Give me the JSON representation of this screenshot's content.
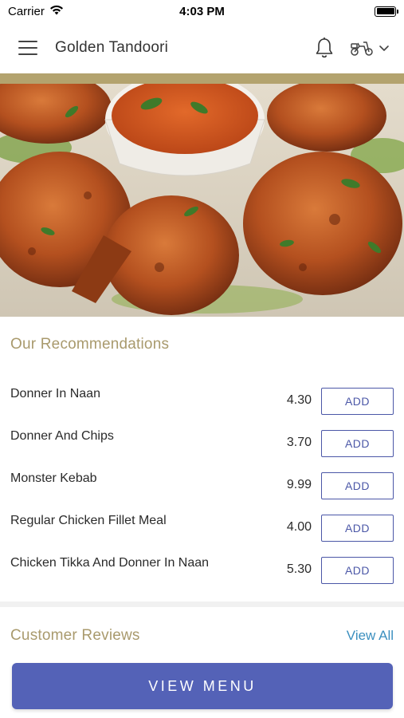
{
  "status_bar": {
    "carrier": "Carrier",
    "time": "4:03 PM"
  },
  "header": {
    "title": "Golden Tandoori",
    "icons": [
      "menu-icon",
      "bell-icon",
      "scooter-icon",
      "chevron-down-icon"
    ]
  },
  "recommendations": {
    "title": "Our Recommendations",
    "add_label": "ADD",
    "items": [
      {
        "name": "Donner In Naan",
        "price": "4.30"
      },
      {
        "name": "Donner And Chips",
        "price": "3.70"
      },
      {
        "name": "Monster Kebab",
        "price": "9.99"
      },
      {
        "name": "Regular Chicken Fillet Meal",
        "price": "4.00"
      },
      {
        "name": "Chicken Tikka And Donner In Naan",
        "price": "5.30"
      }
    ]
  },
  "reviews": {
    "title": "Customer Reviews",
    "view_all": "View All"
  },
  "footer": {
    "view_menu": "VIEW MENU"
  },
  "colors": {
    "gold": "#b3a36e",
    "accent_blue": "#4b57a7",
    "button_blue": "#5462b7",
    "link_blue": "#3b8fbf"
  }
}
